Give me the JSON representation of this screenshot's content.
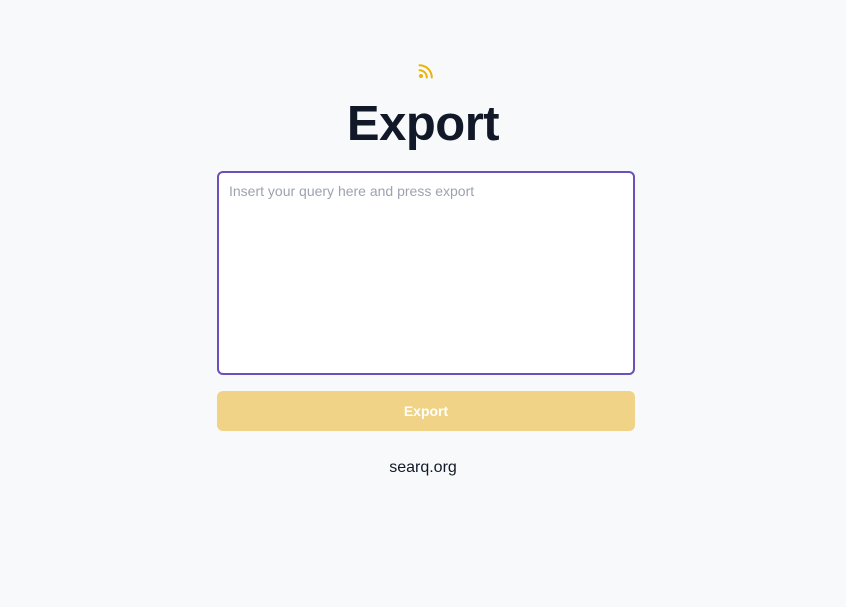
{
  "header": {
    "icon": "rss-icon",
    "icon_color": "#eab308",
    "title": "Export"
  },
  "query": {
    "value": "",
    "placeholder": "Insert your query here and press export",
    "border_color": "#6b4fbb"
  },
  "actions": {
    "export_label": "Export",
    "button_color": "#f0d386"
  },
  "footer": {
    "link_text": "searq.org"
  }
}
